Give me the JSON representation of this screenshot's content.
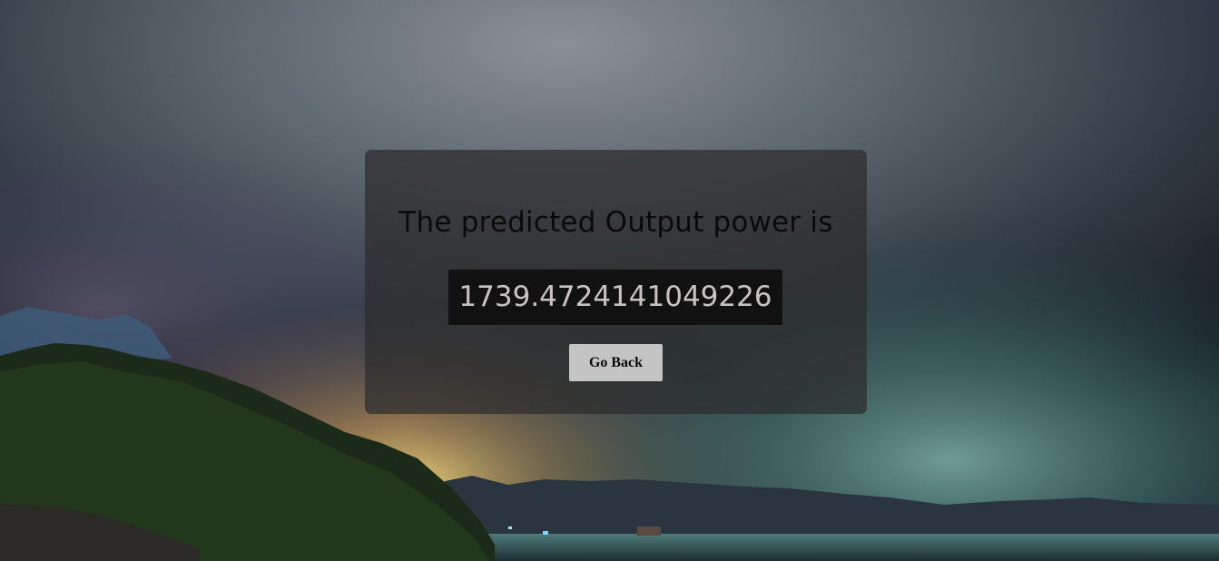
{
  "result": {
    "heading": "The predicted Output power is",
    "value": "1739.4724141049226",
    "back_button_label": "Go Back"
  },
  "colors": {
    "card_background": "rgba(45,45,45,0.72)",
    "result_box_background": "#111111",
    "result_text": "#c9c2c2",
    "button_background": "#c4c4c4"
  }
}
